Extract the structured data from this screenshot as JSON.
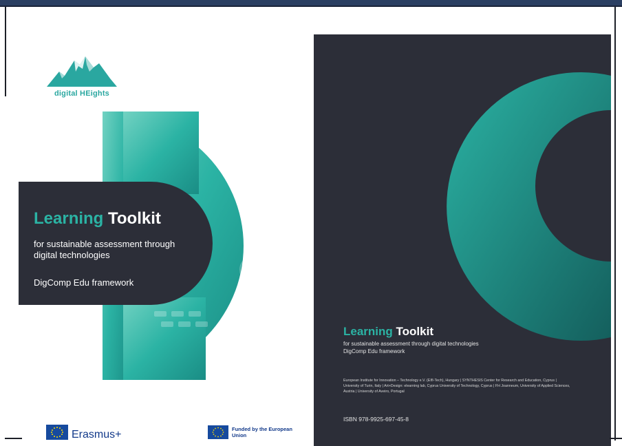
{
  "front_cover": {
    "logo_text": "digital HEights",
    "title_word1": "Learning",
    "title_word2": "Toolkit",
    "subtitle": "for sustainable assessment through digital technologies",
    "framework": "DigComp Edu framework",
    "erasmus_label": "Erasmus+",
    "funded_label": "Funded by the European Union"
  },
  "back_cover": {
    "title_word1": "Learning",
    "title_word2": "Toolkit",
    "subtitle_line1": "for sustainable assessment through digital technologies",
    "subtitle_line2": "DigComp Edu framework",
    "partners": "European Institute for Innovation – Technology e.V. (EIfI-Tech), Hungary | SYNTHESIS Center for Research and Education, Cyprus | University of Turin, Italy | Art+Design: elearning lab, Cyprus University of Technology, Cyprus | FH Joanneum, University of Applied Sciences, Austria | University of Aveiro, Portugal",
    "isbn": "ISBN 978-9925-697-45-8"
  },
  "colors": {
    "teal": "#2bb3a4",
    "dark": "#2c2e38",
    "eu_blue": "#164a9e",
    "eu_star": "#ffdd00"
  }
}
